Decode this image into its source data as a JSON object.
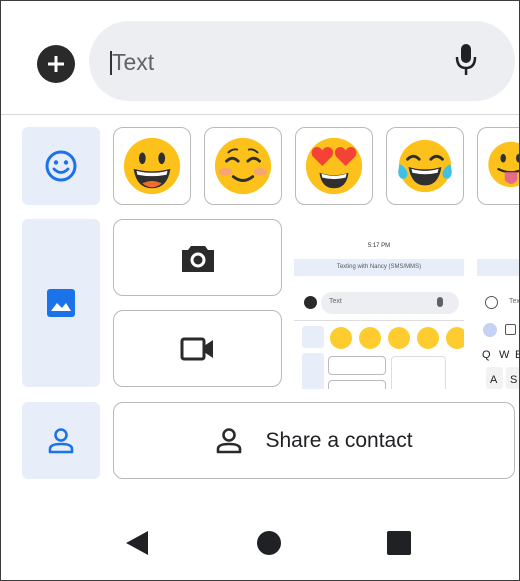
{
  "compose": {
    "placeholder": "Text",
    "attach_icon": "plus-circle-icon",
    "mic_icon": "microphone-icon"
  },
  "emoji_row": {
    "tab_icon": "smiley-icon",
    "items": [
      {
        "name": "grinning-face"
      },
      {
        "name": "smiling-face-blushing"
      },
      {
        "name": "heart-eyes-face"
      },
      {
        "name": "tears-of-joy-face"
      },
      {
        "name": "face-with-tongue"
      }
    ]
  },
  "gallery_row": {
    "tab_icon": "image-icon",
    "camera_icon": "camera-icon",
    "video_icon": "video-camera-icon",
    "thumbnail_1": {
      "time": "5:17 PM",
      "banner": "Texting with Nancy (SMS/MMS)",
      "input_placeholder": "Text"
    },
    "thumbnail_2": {
      "input_placeholder": "Tex",
      "keys_row1": [
        "Q",
        "W",
        "E"
      ],
      "keys_row2": [
        "A",
        "S"
      ]
    }
  },
  "contact_row": {
    "tab_icon": "person-icon",
    "share_label": "Share a contact"
  },
  "navbar": {
    "back": "back-icon",
    "home": "home-icon",
    "recents": "recents-icon"
  },
  "colors": {
    "accent": "#1a73e8",
    "tab_background": "#e8eef9",
    "input_background": "#eceef2"
  }
}
